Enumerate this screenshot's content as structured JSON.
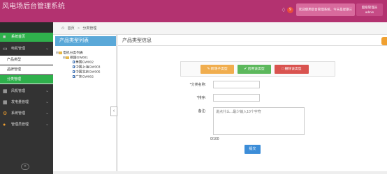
{
  "app": {
    "title": "风电场后台管理系统"
  },
  "header": {
    "bell_count": "9",
    "welcome": "欢迎使用后台管理系统，今天是星期三",
    "user_line1": "超级管理员",
    "user_line2": "admin"
  },
  "sidebar": {
    "items": [
      {
        "label": "系统首页",
        "icon": "home-icon"
      },
      {
        "label": "电机管理",
        "icon": "monitor-icon"
      },
      {
        "label": "产品类型",
        "icon": ""
      },
      {
        "label": "品牌管理",
        "icon": ""
      },
      {
        "label": "分类管理",
        "icon": ""
      },
      {
        "label": "风机管理",
        "icon": "image-icon"
      },
      {
        "label": "发电量管理",
        "icon": "calendar-icon"
      },
      {
        "label": "系统管理",
        "icon": "gears-icon"
      },
      {
        "label": "管理员管理",
        "icon": "users-icon"
      }
    ]
  },
  "breadcrumb": {
    "home": "首页",
    "current": "分类管理"
  },
  "left_panel": {
    "title": "产品类型列表"
  },
  "tree": {
    "root": "电机分类列表",
    "group": "德国GW001",
    "children": [
      "美国GW002",
      "中国上海GW003",
      "中国北京GW005",
      "广东GW002"
    ]
  },
  "right_panel": {
    "title": "产品类型信息"
  },
  "toolbar": {
    "add": "新增子类型",
    "enable": "启用该类型",
    "delete": "删除该类型"
  },
  "form": {
    "name_label": "*分类名称:",
    "sort_label": "*排序:",
    "remark_label": "备注:",
    "remark_placeholder": "说点什么...最少输入10个字符",
    "counter": "0/100",
    "submit": "提交"
  },
  "colors": {
    "header": "#b33270",
    "active": "#2fb04c",
    "panel_head": "#5aa8d8"
  }
}
